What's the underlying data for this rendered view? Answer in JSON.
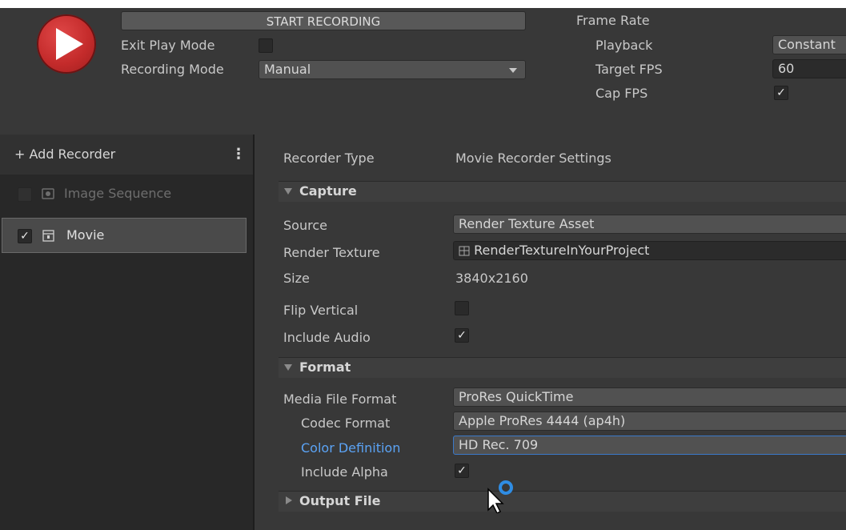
{
  "header": {
    "start_recording": "START RECORDING",
    "exit_play_mode_label": "Exit Play Mode",
    "exit_play_mode_checked": false,
    "recording_mode_label": "Recording Mode",
    "recording_mode_value": "Manual",
    "frame_rate_label": "Frame Rate",
    "playback_label": "Playback",
    "playback_value": "Constant",
    "target_fps_label": "Target FPS",
    "target_fps_value": "60",
    "cap_fps_label": "Cap FPS",
    "cap_fps_checked": true
  },
  "sidebar": {
    "add_recorder": "+ Add Recorder",
    "menu_icon": "⋮",
    "items": [
      {
        "label": "Image Sequence",
        "checked": false,
        "enabled": false,
        "icon": "image-icon"
      },
      {
        "label": "Movie",
        "checked": true,
        "enabled": true,
        "icon": "movie-icon",
        "selected": true
      }
    ]
  },
  "main": {
    "recorder_type_label": "Recorder Type",
    "recorder_type_value": "Movie Recorder Settings",
    "capture": {
      "title": "Capture",
      "source_label": "Source",
      "source_value": "Render Texture Asset",
      "render_texture_label": "Render Texture",
      "render_texture_value": "RenderTextureInYourProject",
      "size_label": "Size",
      "size_value": "3840x2160",
      "flip_vertical_label": "Flip Vertical",
      "flip_vertical_checked": false,
      "include_audio_label": "Include Audio",
      "include_audio_checked": true
    },
    "format": {
      "title": "Format",
      "media_file_format_label": "Media File Format",
      "media_file_format_value": "ProRes QuickTime",
      "codec_format_label": "Codec Format",
      "codec_format_value": "Apple ProRes 4444 (ap4h)",
      "color_definition_label": "Color Definition",
      "color_definition_value": "HD Rec. 709",
      "include_alpha_label": "Include Alpha",
      "include_alpha_checked": true
    },
    "output_file": {
      "title": "Output File"
    }
  },
  "colors": {
    "play_button": "#c42b2b",
    "highlight_label": "#5ba3f5",
    "focus_border": "#3a79c9"
  },
  "check_glyph": "✓"
}
